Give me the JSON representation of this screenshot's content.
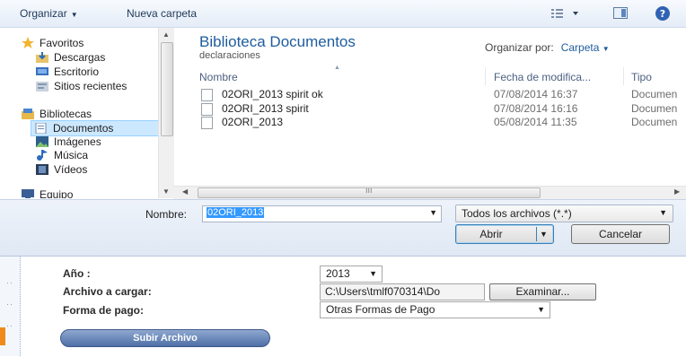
{
  "toolbar": {
    "organize": "Organizar",
    "new_folder": "Nueva carpeta"
  },
  "nav": {
    "favorites": "Favoritos",
    "downloads": "Descargas",
    "desktop": "Escritorio",
    "recent": "Sitios recientes",
    "libraries": "Bibliotecas",
    "documents": "Documentos",
    "images": "Imágenes",
    "music": "Música",
    "videos": "Vídeos",
    "computer": "Equipo"
  },
  "content": {
    "title": "Biblioteca Documentos",
    "subtitle": "declaraciones",
    "arrange_label": "Organizar por:",
    "arrange_value": "Carpeta",
    "columns": {
      "name": "Nombre",
      "date": "Fecha de modifica...",
      "type": "Tipo"
    },
    "files": [
      {
        "name": "02ORI_2013 spirit ok",
        "date": "07/08/2014 16:37",
        "type": "Documen"
      },
      {
        "name": "02ORI_2013 spirit",
        "date": "07/08/2014 16:16",
        "type": "Documen"
      },
      {
        "name": "02ORI_2013",
        "date": "05/08/2014 11:35",
        "type": "Documen"
      }
    ]
  },
  "bottom": {
    "name_label": "Nombre:",
    "name_value": "02ORI_2013",
    "filter": "Todos los archivos (*.*)",
    "open": "Abrir",
    "cancel": "Cancelar"
  },
  "form": {
    "year_label": "Año :",
    "year_value": "2013",
    "file_label": "Archivo a cargar:",
    "file_value": "C:\\Users\\tmlf070314\\Do",
    "browse": "Examinar...",
    "payment_label": "Forma de pago:",
    "payment_value": "Otras Formas de Pago",
    "submit": "Subir Archivo"
  },
  "colors": {
    "accent": "#1e5c9e",
    "selection": "#cce8ff",
    "highlight": "#3399ff",
    "submit": "#4e6fa6"
  }
}
